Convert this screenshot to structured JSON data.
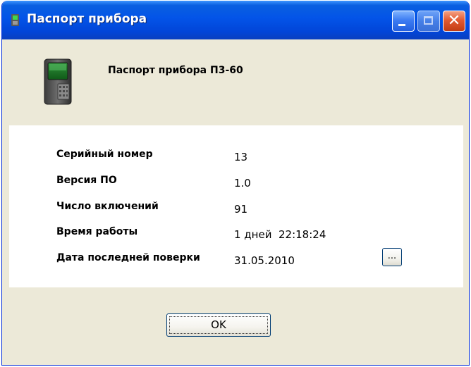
{
  "window": {
    "title": "Паспорт прибора",
    "header_title": "Паспорт прибора П3-60"
  },
  "titlebar_controls": {
    "minimize_icon": "minimize-icon",
    "maximize_icon": "maximize-icon",
    "close_icon": "close-icon",
    "close_glyph": "✕"
  },
  "fields": [
    {
      "label": "Серийный номер",
      "value": "13"
    },
    {
      "label": "Версия ПО",
      "value": "1.0"
    },
    {
      "label": "Число включений",
      "value": "91"
    },
    {
      "label": "Время работы",
      "value": "1 дней  22:18:24"
    },
    {
      "label": "Дата последней поверки",
      "value": "31.05.2010"
    }
  ],
  "browse_button": {
    "label": "..."
  },
  "ok_button": {
    "label": "OK"
  },
  "colors": {
    "titlebar": "#0354e8",
    "dialog_bg": "#ece9d8",
    "panel_bg": "#ffffff",
    "close_button": "#e25a31"
  }
}
